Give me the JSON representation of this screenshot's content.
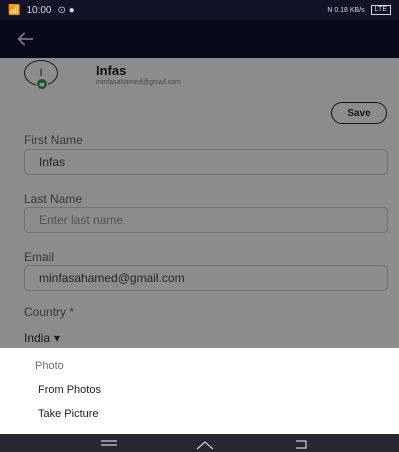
{
  "status_bar": {
    "left_signal": "📶",
    "time": "10:00",
    "right_status": "N 0.18 KB/s",
    "battery": "LTE"
  },
  "header": {
    "back_icon": "arrow-left-icon"
  },
  "profile": {
    "avatar_initial": "I",
    "name": "Infas",
    "email": "minfasahamed@gmail.com",
    "save_label": "Save"
  },
  "form": {
    "first_name": {
      "label": "First Name",
      "value": "Infas"
    },
    "last_name": {
      "label": "Last Name",
      "placeholder": "Enter last name"
    },
    "email": {
      "label": "Email",
      "value": "minfasahamed@gmail.com"
    },
    "country": {
      "label": "Country *",
      "value": "India"
    }
  },
  "bottom_sheet": {
    "title": "Photo",
    "options": [
      "From Photos",
      "Take Picture"
    ]
  },
  "nav_bar": {
    "icons": [
      "menu-icon",
      "home-icon",
      "back-icon"
    ]
  },
  "colors": {
    "app_bar": "#0f1130",
    "status_bar": "#111426",
    "badge": "#2a9d4b"
  }
}
